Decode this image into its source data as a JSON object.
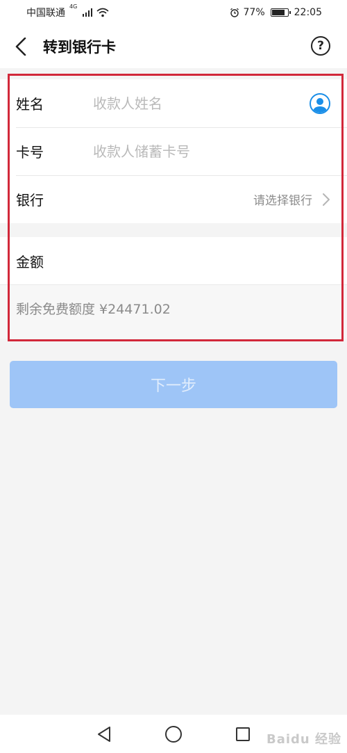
{
  "status": {
    "carrier": "中国联通",
    "network": "4G",
    "battery": "77%",
    "battery_level": 0.77,
    "time": "22:05"
  },
  "header": {
    "title": "转到银行卡",
    "help_symbol": "?"
  },
  "form": {
    "name_label": "姓名",
    "name_placeholder": "收款人姓名",
    "card_label": "卡号",
    "card_placeholder": "收款人储蓄卡号",
    "bank_label": "银行",
    "bank_placeholder": "请选择银行",
    "amount_label": "金额",
    "remaining_quota": "剩余免费额度 ¥24471.02"
  },
  "next_button": {
    "label": "下一步"
  },
  "colors": {
    "accent": "#1a8ee8",
    "button_disabled": "#9ec5f7",
    "highlight": "#d2283a"
  },
  "watermark": "Baidu 经验"
}
